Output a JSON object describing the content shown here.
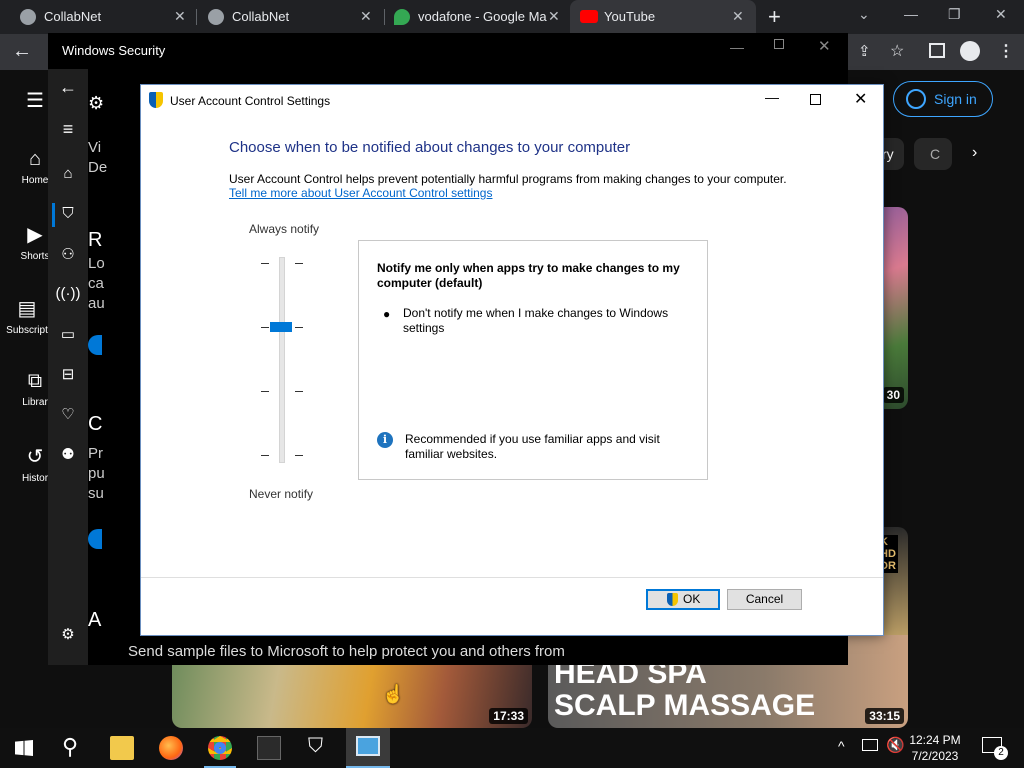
{
  "browser": {
    "tabs": [
      {
        "label": "CollabNet",
        "icon": "globe-icon"
      },
      {
        "label": "CollabNet",
        "icon": "globe-icon"
      },
      {
        "label": "vodafone - Google Ma",
        "icon": "maps-pin-icon"
      },
      {
        "label": "YouTube",
        "icon": "youtube-icon"
      }
    ],
    "new_tab": "+",
    "sign_in": "Sign in"
  },
  "youtube": {
    "sidebar": [
      {
        "label": "Home",
        "icon": "home-icon"
      },
      {
        "label": "Shorts",
        "icon": "shorts-icon"
      },
      {
        "label": "Subscript",
        "icon": "subscriptions-icon"
      },
      {
        "label": "Librar",
        "icon": "library-icon"
      },
      {
        "label": "Histor",
        "icon": "history-icon"
      }
    ],
    "chip_partial": "ry",
    "chip_partial2": "C",
    "thumb_durations": [
      "30",
      "17:33",
      "33:15"
    ],
    "thumb_text_lines": [
      "HEAD SPA",
      "SCALP MASSAGE"
    ],
    "thumb_badge": [
      "K",
      "HD",
      "DR"
    ]
  },
  "windows_security": {
    "title": "Windows Security",
    "content_snippets": [
      "Vi",
      "De",
      "R",
      "Lo",
      "ca",
      "au",
      "C",
      "Pr",
      "pu",
      "su",
      "A"
    ],
    "bottom_text": "Send sample files to Microsoft to help protect you and others from"
  },
  "uac": {
    "title": "User Account Control Settings",
    "heading": "Choose when to be notified about changes to your computer",
    "description": "User Account Control helps prevent potentially harmful programs from making changes to your computer.",
    "link": "Tell me more about User Account Control settings",
    "slider": {
      "top_label": "Always notify",
      "bottom_label": "Never notify",
      "levels": 4,
      "selected_level": 3
    },
    "info": {
      "title": "Notify me only when apps try to make changes to my computer (default)",
      "bullet": "Don't notify me when I make changes to Windows settings",
      "recommendation": "Recommended if you use familiar apps and visit familiar websites.",
      "info_glyph": "i"
    },
    "ok_label": "OK",
    "cancel_label": "Cancel"
  },
  "taskbar": {
    "time": "12:24 PM",
    "date": "7/2/2023",
    "notification_count": "2"
  }
}
